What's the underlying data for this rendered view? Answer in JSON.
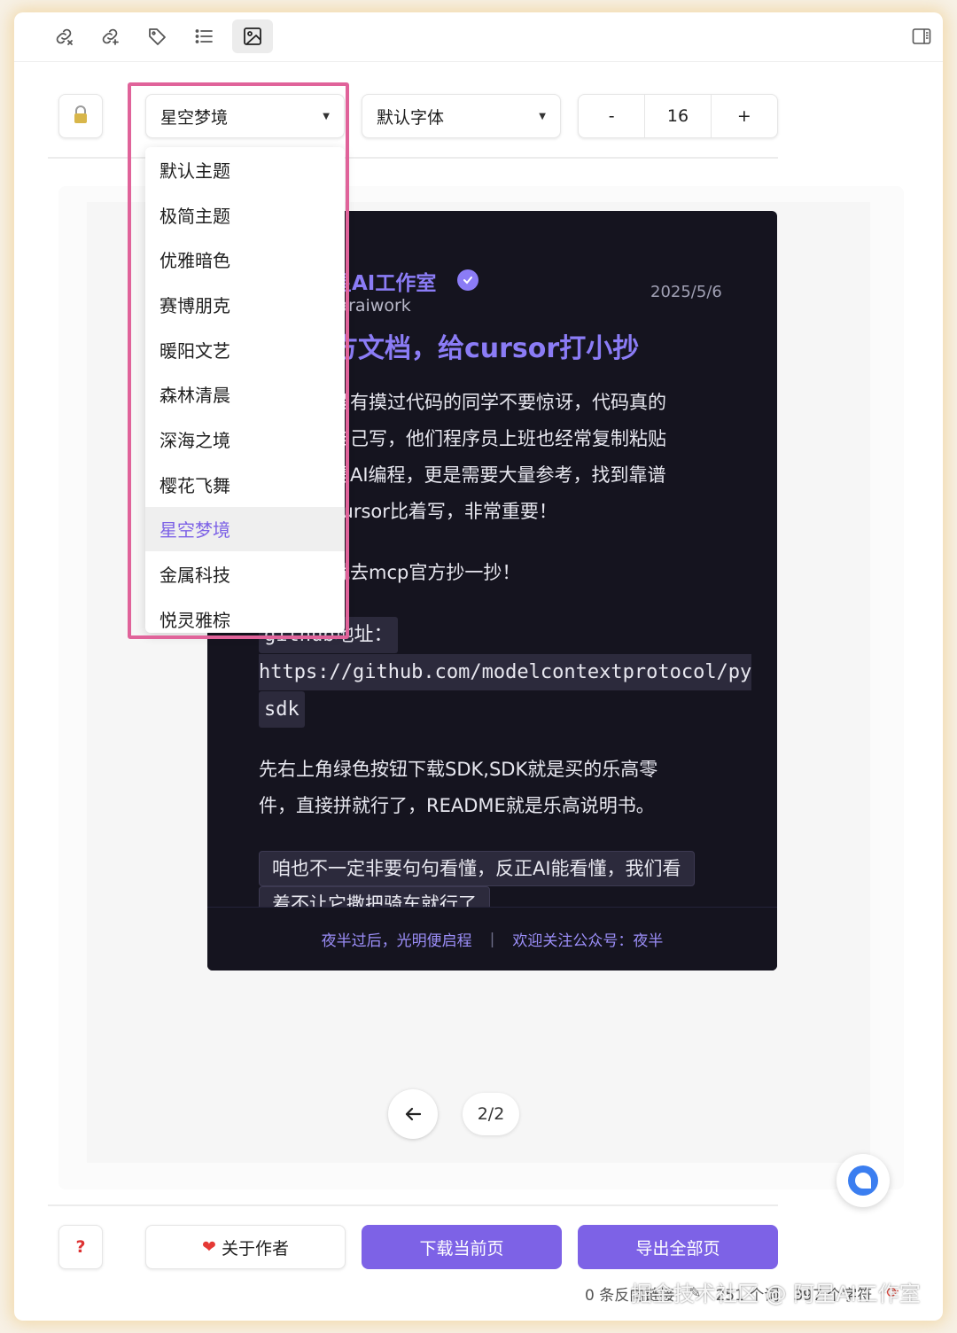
{
  "toolbar": {
    "icons": [
      "link-icon",
      "unlink-icon",
      "tag-icon",
      "list-icon",
      "image-icon"
    ],
    "right_icon": "sidebar-toggle-icon"
  },
  "controls": {
    "lock_icon": "lock-icon",
    "theme_select": "星空梦境",
    "font_select": "默认字体",
    "font_size": "16",
    "decrease_label": "-",
    "increase_label": "+"
  },
  "theme_dropdown": {
    "items": [
      "默认主题",
      "极简主题",
      "优雅暗色",
      "赛博朋克",
      "暖阳文艺",
      "森林清晨",
      "深海之境",
      "樱花飞舞",
      "星空梦境",
      "金属科技",
      "悦灵雅棕"
    ],
    "selected": "星空梦境"
  },
  "card": {
    "author": "星AI工作室",
    "handle": "taraiwork",
    "date": "2025/5/6",
    "title": "方文档，给cursor打小抄",
    "para1": [
      "没有摸过代码的同学不要惊讶，代码真的",
      "自己写，他们程序员上班也经常复制粘贴",
      "是AI编程，更是需要大量参考，找到靠谱",
      "cursor比着写，非常重要！"
    ],
    "para2": "就去mcp官方抄一抄！",
    "code1": "github地址：",
    "code2": "https://github.com/modelcontextprotocol/py",
    "code3": "sdk",
    "para3": [
      "先右上角绿色按钮下载SDK,SDK就是买的乐高零",
      "件，直接拼就行了，README就是乐高说明书。"
    ],
    "quote1": "咱也不一定非要句句看懂，反正AI能看懂，我们看",
    "quote2": "着不让它撒把骑车就行了",
    "footer_left": "夜半过后，光明便启程",
    "footer_sep": "|",
    "footer_right": "欢迎关注公众号：夜半"
  },
  "pager": {
    "prev_icon": "arrow-left-icon",
    "label": "2/2"
  },
  "actions": {
    "help_label": "?",
    "about_label": "关于作者",
    "about_icon": "heart-icon",
    "download_label": "下载当前页",
    "export_label": "导出全部页"
  },
  "status": {
    "backlinks": "0 条反向链接",
    "words": "251 个词",
    "chars": "397 个字符"
  },
  "watermark": "掘金技术社区 @ 阿星AI工作室",
  "colors": {
    "accent": "#7d62e6",
    "card_bg": "#15141f",
    "highlight": "#e0639a"
  }
}
